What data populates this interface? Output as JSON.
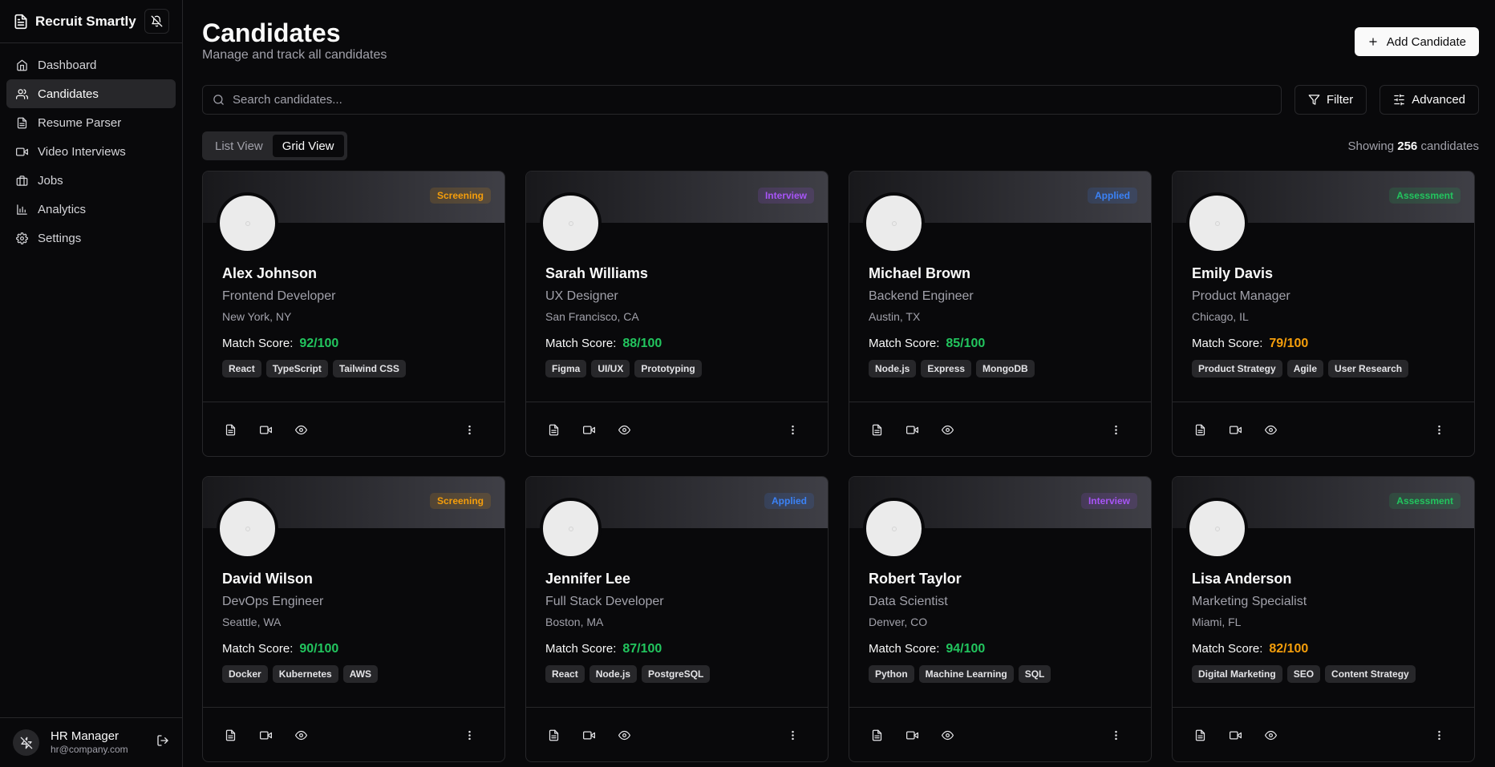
{
  "app": {
    "name": "Recruit Smartly"
  },
  "sidebar": {
    "items": [
      {
        "label": "Dashboard",
        "icon": "home-icon"
      },
      {
        "label": "Candidates",
        "icon": "users-icon"
      },
      {
        "label": "Resume Parser",
        "icon": "file-text-icon"
      },
      {
        "label": "Video Interviews",
        "icon": "video-icon"
      },
      {
        "label": "Jobs",
        "icon": "briefcase-icon"
      },
      {
        "label": "Analytics",
        "icon": "bar-chart-icon"
      },
      {
        "label": "Settings",
        "icon": "gear-icon"
      }
    ],
    "active": "Candidates"
  },
  "user": {
    "name": "HR Manager",
    "email": "hr@company.com"
  },
  "header": {
    "title": "Candidates",
    "subtitle": "Manage and track all candidates",
    "add_label": "Add Candidate"
  },
  "search": {
    "placeholder": "Search candidates..."
  },
  "filters": {
    "filter_label": "Filter",
    "advanced_label": "Advanced"
  },
  "view": {
    "list_label": "List View",
    "grid_label": "Grid View",
    "active": "Grid View"
  },
  "showing": {
    "prefix": "Showing",
    "count": "256",
    "suffix": "candidates"
  },
  "score_label": "Match Score:",
  "colors": {
    "screening": "#f59e0b",
    "interview": "#a855f7",
    "applied": "#3b82f6",
    "assessment": "#22c55e",
    "score_green": "#22c55e",
    "score_orange": "#f59e0b"
  },
  "candidates": [
    {
      "name": "Alex Johnson",
      "role": "Frontend Developer",
      "location": "New York, NY",
      "score": "92/100",
      "score_color": "green",
      "status": "Screening",
      "status_key": "screening",
      "skills": [
        "React",
        "TypeScript",
        "Tailwind CSS"
      ]
    },
    {
      "name": "Sarah Williams",
      "role": "UX Designer",
      "location": "San Francisco, CA",
      "score": "88/100",
      "score_color": "green",
      "status": "Interview",
      "status_key": "interview",
      "skills": [
        "Figma",
        "UI/UX",
        "Prototyping"
      ]
    },
    {
      "name": "Michael Brown",
      "role": "Backend Engineer",
      "location": "Austin, TX",
      "score": "85/100",
      "score_color": "green",
      "status": "Applied",
      "status_key": "applied",
      "skills": [
        "Node.js",
        "Express",
        "MongoDB"
      ]
    },
    {
      "name": "Emily Davis",
      "role": "Product Manager",
      "location": "Chicago, IL",
      "score": "79/100",
      "score_color": "orange",
      "status": "Assessment",
      "status_key": "assessment",
      "skills": [
        "Product Strategy",
        "Agile",
        "User Research"
      ]
    },
    {
      "name": "David Wilson",
      "role": "DevOps Engineer",
      "location": "Seattle, WA",
      "score": "90/100",
      "score_color": "green",
      "status": "Screening",
      "status_key": "screening",
      "skills": [
        "Docker",
        "Kubernetes",
        "AWS"
      ]
    },
    {
      "name": "Jennifer Lee",
      "role": "Full Stack Developer",
      "location": "Boston, MA",
      "score": "87/100",
      "score_color": "green",
      "status": "Applied",
      "status_key": "applied",
      "skills": [
        "React",
        "Node.js",
        "PostgreSQL"
      ]
    },
    {
      "name": "Robert Taylor",
      "role": "Data Scientist",
      "location": "Denver, CO",
      "score": "94/100",
      "score_color": "green",
      "status": "Interview",
      "status_key": "interview",
      "skills": [
        "Python",
        "Machine Learning",
        "SQL"
      ]
    },
    {
      "name": "Lisa Anderson",
      "role": "Marketing Specialist",
      "location": "Miami, FL",
      "score": "82/100",
      "score_color": "orange",
      "status": "Assessment",
      "status_key": "assessment",
      "skills": [
        "Digital Marketing",
        "SEO",
        "Content Strategy"
      ]
    }
  ]
}
